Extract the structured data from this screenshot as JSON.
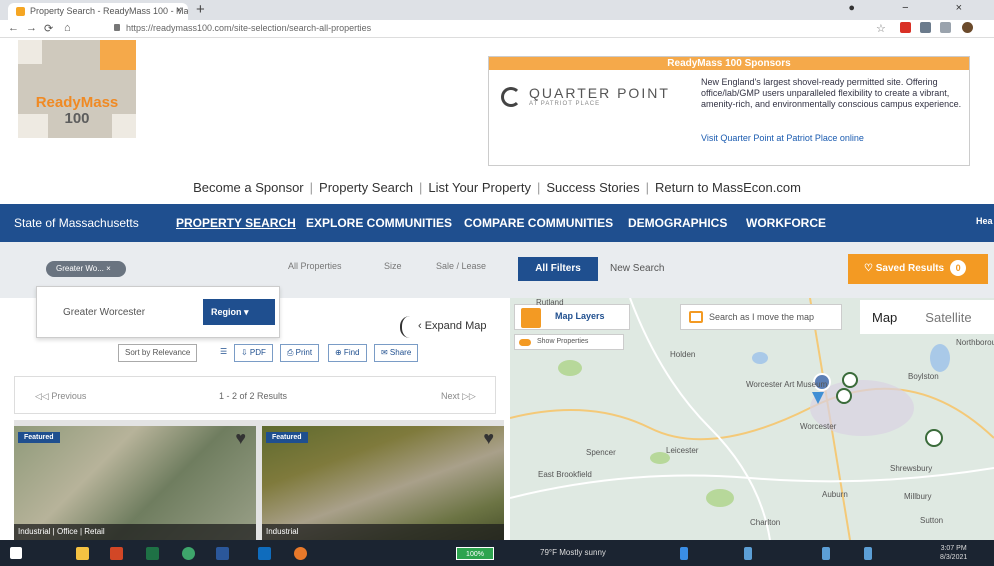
{
  "browser": {
    "tab_title": "Property Search - ReadyMass 100 - Ma...",
    "tab_close": "×",
    "new_tab": "+",
    "url": "https://readymass100.com/site-selection/search-all-properties",
    "window_controls": "● − ×"
  },
  "logo": {
    "line1": "ReadyMass",
    "line2": "100"
  },
  "sponsor": {
    "header": "ReadyMass 100 Sponsors",
    "name": "QUARTER POINT",
    "sub": "AT PATRIOT PLACE",
    "description": "New England's largest shovel-ready permitted site. Offering office/lab/GMP users unparalleled flexibility to create a vibrant, amenity-rich, and environmentally conscious campus experience.",
    "link": "Visit Quarter Point at Patriot Place online"
  },
  "top_links": [
    "Become a Sponsor",
    "Property Search",
    "List Your Property",
    "Success Stories",
    "Return to MassEcon.com"
  ],
  "nav": {
    "state": "State of Massachusetts",
    "items": [
      "PROPERTY SEARCH",
      "EXPLORE COMMUNITIES",
      "COMPARE COMMUNITIES",
      "DEMOGRAPHICS",
      "WORKFORCE"
    ],
    "overflow": "Hea"
  },
  "filters": {
    "region_pill": "Greater Wo...  ×",
    "tabs": [
      "All Properties",
      "Size",
      "Sale / Lease"
    ],
    "all_filters": "All Filters",
    "new_search": "New Search",
    "saved_results": "♡  Saved Results",
    "saved_count": "0"
  },
  "region_dropdown": {
    "value": "Greater Worcester",
    "button": "Region  ▾"
  },
  "list": {
    "expand_map": "‹  Expand Map",
    "sort_label": "Sort by Relevance",
    "sort_buttons": [
      "☰",
      "⇩ PDF",
      "⎙ Print",
      "⊕ Find",
      "✉ Share"
    ],
    "results_left": "◁◁ Previous",
    "results_center": "1 - 2 of 2 Results",
    "results_right": "Next ▷▷",
    "cards": [
      {
        "tag": "Featured",
        "type": "Industrial | Office | Retail"
      },
      {
        "tag": "Featured",
        "type": "Industrial"
      }
    ]
  },
  "map": {
    "layers_label": "Map Layers",
    "show_properties": "Show Properties",
    "search_move": "Search as I move the map",
    "map_btn": "Map",
    "satellite_btn": "Satellite",
    "labels": [
      "Rutland",
      "Holden",
      "Worcester Art Museum",
      "Worcester",
      "Spencer",
      "Leicester",
      "Shrewsbury",
      "Auburn",
      "Millbury",
      "East Brookfield",
      "Sutton",
      "Northborough",
      "Boylston",
      "Charlton"
    ]
  },
  "taskbar": {
    "battery": "100%",
    "weather": "79°F Mostly sunny",
    "time": "3:07 PM",
    "date": "8/3/2021"
  }
}
